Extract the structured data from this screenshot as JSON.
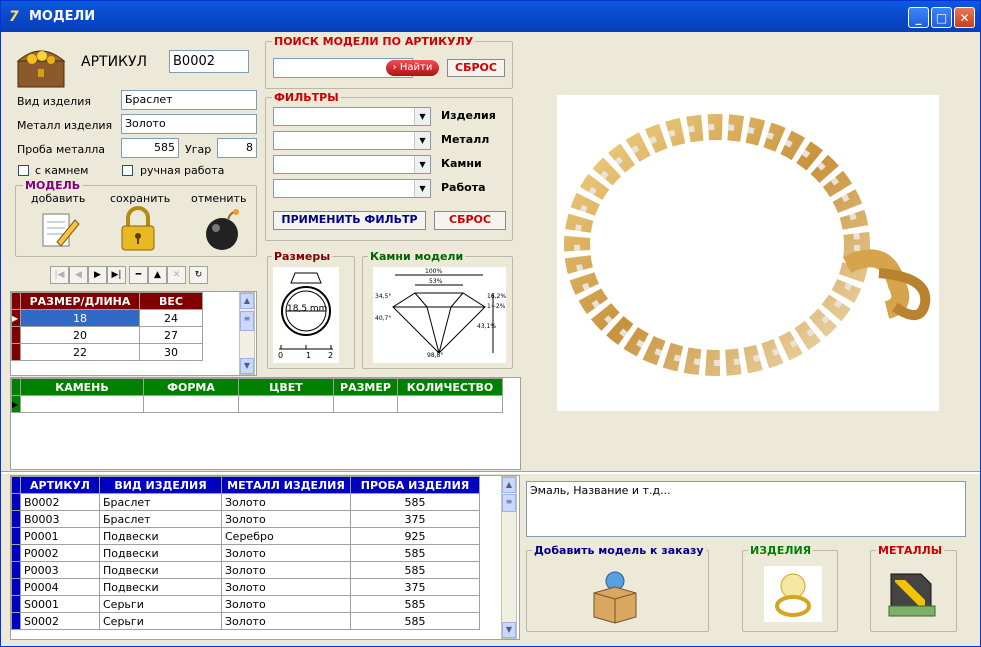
{
  "window": {
    "title": "МОДЕЛИ",
    "min_label": "_",
    "max_label": "□",
    "close_label": "✕"
  },
  "artikul": {
    "label": "АРТИКУЛ",
    "value": "B0002"
  },
  "search": {
    "title": "ПОИСК МОДЕЛИ ПО АРТИКУЛУ",
    "value": "",
    "find_label": "Найти",
    "reset_label": "СБРОС"
  },
  "fields": {
    "vid_label": "Вид изделия",
    "vid_value": "Браслет",
    "metal_label": "Металл изделия",
    "metal_value": "Золото",
    "proba_label": "Проба металла",
    "proba_value": "585",
    "ugar_label": "Угар",
    "ugar_value": "8",
    "stone_label": "с камнем",
    "handwork_label": "ручная работа"
  },
  "model_group": {
    "title": "МОДЕЛЬ",
    "add_label": "добавить",
    "save_label": "сохранить",
    "cancel_label": "отменить"
  },
  "filters": {
    "title": "ФИЛЬТРЫ",
    "labels": [
      "Изделия",
      "Металл",
      "Камни",
      "Работа"
    ],
    "apply_label": "ПРИМЕНИТЬ ФИЛЬТР",
    "reset_label": "СБРОС"
  },
  "sizes_group": {
    "title": "Размеры",
    "ring_label": "18,5 mm",
    "ruler": [
      "0",
      "1",
      "2"
    ]
  },
  "stones_group": {
    "title": "Камни модели",
    "diagram_labels": [
      "100%",
      "53%",
      "34,5°",
      "40,7°",
      "16,2%",
      "1~2%",
      "43,1%",
      "98,8°"
    ]
  },
  "sizes_table": {
    "headers": [
      "РАЗМЕР/ДЛИНА",
      "ВЕС"
    ],
    "rows": [
      [
        "18",
        "24"
      ],
      [
        "20",
        "27"
      ],
      [
        "22",
        "30"
      ]
    ]
  },
  "stones_table": {
    "headers": [
      "КАМЕНЬ",
      "ФОРМА",
      "ЦВЕТ",
      "РАЗМЕР",
      "КОЛИЧЕСТВО"
    ]
  },
  "models_table": {
    "headers": [
      "АРТИКУЛ",
      "ВИД ИЗДЕЛИЯ",
      "МЕТАЛЛ ИЗДЕЛИЯ",
      "ПРОБА ИЗДЕЛИЯ"
    ],
    "rows": [
      [
        "B0002",
        "Браслет",
        "Золото",
        "585"
      ],
      [
        "B0003",
        "Браслет",
        "Золото",
        "375"
      ],
      [
        "P0001",
        "Подвески",
        "Серебро",
        "925"
      ],
      [
        "P0002",
        "Подвески",
        "Золото",
        "585"
      ],
      [
        "P0003",
        "Подвески",
        "Золото",
        "585"
      ],
      [
        "P0004",
        "Подвески",
        "Золото",
        "375"
      ],
      [
        "S0001",
        "Серьги",
        "Золото",
        "585"
      ],
      [
        "S0002",
        "Серьги",
        "Золото",
        "585"
      ]
    ]
  },
  "note": {
    "value": "Эмаль, Название и т.д..."
  },
  "order_group": {
    "title": "Добавить модель к заказу"
  },
  "products_group": {
    "title": "ИЗДЕЛИЯ"
  },
  "metals_group": {
    "title": "МЕТАЛЛЫ"
  },
  "colors": {
    "titlebar": "#0a4bd0",
    "accent_red": "#cc0000",
    "header_red": "#800000",
    "header_green": "#008000",
    "header_blue": "#0000c0",
    "selection": "#3169c6"
  }
}
